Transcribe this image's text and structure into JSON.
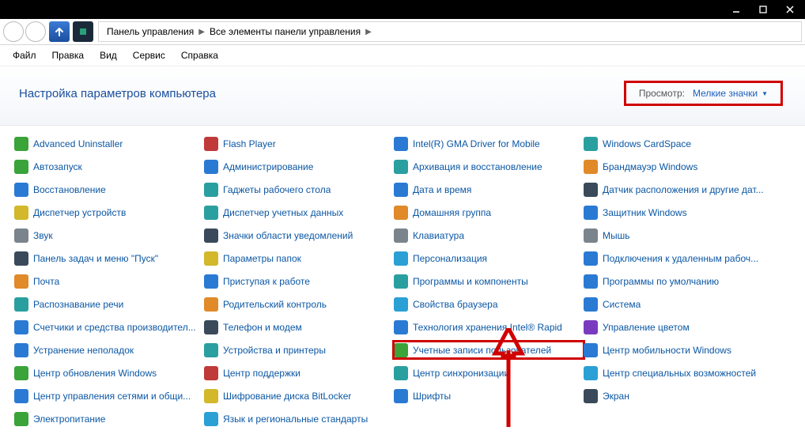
{
  "titlebar": {
    "minimize": "—",
    "maximize": "▢",
    "close": "✕"
  },
  "breadcrumb": {
    "parts": [
      "Панель управления",
      "Все элементы панели управления"
    ]
  },
  "menu": {
    "file": "Файл",
    "edit": "Правка",
    "view": "Вид",
    "tools": "Сервис",
    "help": "Справка"
  },
  "header": {
    "title": "Настройка параметров компьютера",
    "view_label": "Просмотр:",
    "view_value": "Мелкие значки"
  },
  "items": [
    {
      "label": "Advanced Uninstaller",
      "icon": "bg-green"
    },
    {
      "label": "Flash Player",
      "icon": "bg-red"
    },
    {
      "label": "Intel(R) GMA Driver for Mobile",
      "icon": "bg-blue"
    },
    {
      "label": "Windows CardSpace",
      "icon": "bg-teal"
    },
    {
      "label": "Автозапуск",
      "icon": "bg-green"
    },
    {
      "label": "Администрирование",
      "icon": "bg-blue"
    },
    {
      "label": "Архивация и восстановление",
      "icon": "bg-teal"
    },
    {
      "label": "Брандмауэр Windows",
      "icon": "bg-orange"
    },
    {
      "label": "Восстановление",
      "icon": "bg-blue"
    },
    {
      "label": "Гаджеты рабочего стола",
      "icon": "bg-teal"
    },
    {
      "label": "Дата и время",
      "icon": "bg-blue"
    },
    {
      "label": "Датчик расположения и другие дат...",
      "icon": "bg-dark"
    },
    {
      "label": "Диспетчер устройств",
      "icon": "bg-yellow"
    },
    {
      "label": "Диспетчер учетных данных",
      "icon": "bg-teal"
    },
    {
      "label": "Домашняя группа",
      "icon": "bg-orange"
    },
    {
      "label": "Защитник Windows",
      "icon": "bg-blue"
    },
    {
      "label": "Звук",
      "icon": "bg-gray"
    },
    {
      "label": "Значки области уведомлений",
      "icon": "bg-dark"
    },
    {
      "label": "Клавиатура",
      "icon": "bg-gray"
    },
    {
      "label": "Мышь",
      "icon": "bg-gray"
    },
    {
      "label": "Панель задач и меню \"Пуск\"",
      "icon": "bg-dark"
    },
    {
      "label": "Параметры папок",
      "icon": "bg-yellow"
    },
    {
      "label": "Персонализация",
      "icon": "bg-cyan"
    },
    {
      "label": "Подключения к удаленным рабоч...",
      "icon": "bg-blue"
    },
    {
      "label": "Почта",
      "icon": "bg-orange"
    },
    {
      "label": "Приступая к работе",
      "icon": "bg-blue"
    },
    {
      "label": "Программы и компоненты",
      "icon": "bg-teal"
    },
    {
      "label": "Программы по умолчанию",
      "icon": "bg-blue"
    },
    {
      "label": "Распознавание речи",
      "icon": "bg-teal"
    },
    {
      "label": "Родительский контроль",
      "icon": "bg-orange"
    },
    {
      "label": "Свойства браузера",
      "icon": "bg-cyan"
    },
    {
      "label": "Система",
      "icon": "bg-blue"
    },
    {
      "label": "Счетчики и средства производител...",
      "icon": "bg-blue"
    },
    {
      "label": "Телефон и модем",
      "icon": "bg-dark"
    },
    {
      "label": "Технология хранения Intel® Rapid",
      "icon": "bg-blue"
    },
    {
      "label": "Управление цветом",
      "icon": "bg-purple"
    },
    {
      "label": "Устранение неполадок",
      "icon": "bg-blue"
    },
    {
      "label": "Устройства и принтеры",
      "icon": "bg-teal"
    },
    {
      "label": "Учетные записи пользователей",
      "icon": "bg-green",
      "highlight": true
    },
    {
      "label": "Центр мобильности Windows",
      "icon": "bg-blue"
    },
    {
      "label": "Центр обновления Windows",
      "icon": "bg-green"
    },
    {
      "label": "Центр поддержки",
      "icon": "bg-red"
    },
    {
      "label": "Центр синхронизации",
      "icon": "bg-teal"
    },
    {
      "label": "Центр специальных возможностей",
      "icon": "bg-cyan"
    },
    {
      "label": "Центр управления сетями и общи...",
      "icon": "bg-blue"
    },
    {
      "label": "Шифрование диска BitLocker",
      "icon": "bg-yellow"
    },
    {
      "label": "Шрифты",
      "icon": "bg-blue"
    },
    {
      "label": "Экран",
      "icon": "bg-dark"
    },
    {
      "label": "Электропитание",
      "icon": "bg-green"
    },
    {
      "label": "Язык и региональные стандарты",
      "icon": "bg-cyan"
    }
  ]
}
